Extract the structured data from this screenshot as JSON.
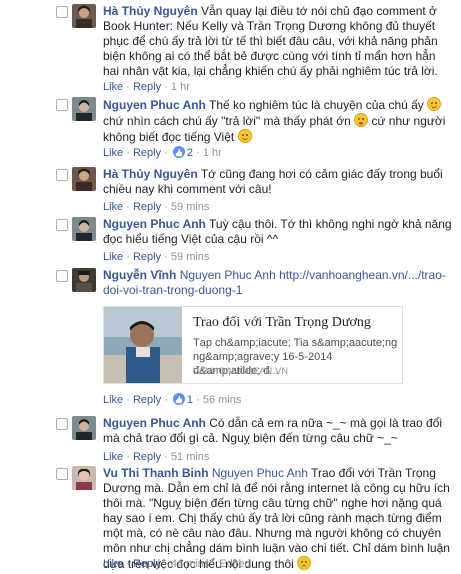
{
  "comments": [
    {
      "author": "Hà Thủy Nguyên",
      "body": "Vẫn quay lại điều tớ nói chủ đạo comment ở Book Hunter: Nếu Kelly và Trần Trọng Dương không đủ thuyết phục để chú ấy trả lời từ tế thì biết đâu câu, với khả năng phản biện không ai có thể bắt bẻ được cùng với tính tỉ mẩn hơn hẳn hai nhân vật kia, lại chẳng khiến chú ấy phải nghiêm túc trả lời.",
      "like": "Like",
      "reply": "Reply",
      "time": "1 hr"
    },
    {
      "author": "Nguyen Phuc Anh",
      "body_1": "Thế ko nghiêm túc là chuyện của chú ấy",
      "body_2": "chứ nhìn cách chú ấy \"trả lời\" mà thấy phát ớn",
      "body_3": "cứ như người không biết đọc tiếng Việt",
      "like": "Like",
      "reply": "Reply",
      "like_count": "2",
      "time": "1 hr"
    },
    {
      "author": "Hà Thủy Nguyên",
      "body": "Tớ cũng đang hơi có cảm giác đấy trong buổi chiều nay khi comment với câu!",
      "like": "Like",
      "reply": "Reply",
      "time": "59 mins"
    },
    {
      "author": "Nguyen Phuc Anh",
      "body": "Tuỳ cậu thôi. Tớ thì không nghi ngờ khả năng đọc hiểu tiếng Việt của cậu rồi ^^",
      "like": "Like",
      "reply": "Reply",
      "time": "59 mins"
    },
    {
      "author": "Nguyễn Vĩnh",
      "tagged": "Nguyen Phuc Anh",
      "link": "http://vanhoanghean.vn/.../trao-doi-voi-tran-trong-duong-1",
      "link_line1": "http://vanhoanghean.vn/.../trao-",
      "link_line2": "doi-voi-tran-trong-duong-1",
      "preview": {
        "title": "Trao đổi với Trần Trọng Dương",
        "desc_1": "Tạp ch&amp;iacute; Tia s&amp;aacute;ng",
        "desc_2": "ng&amp;agrave;y 16-5-2014 đ&amp;atilde; đ...",
        "domain": "VANHOANGHEAN.VN"
      },
      "like": "Like",
      "reply": "Reply",
      "like_count": "1",
      "time": "56 mins"
    },
    {
      "author": "Nguyen Phuc Anh",
      "body": "Có dẫn cả em ra nữa ~_~ mà gọi là trao đổi mà chả trao đổi gì cả. Nguỵ biện đến từng câu chữ ~_~",
      "like": "Like",
      "reply": "Reply",
      "time": "51 mins"
    },
    {
      "author": "Vu Thi Thanh Binh",
      "tagged": "Nguyen Phuc Anh",
      "body": "Trao đổi với Trần Trọng Dương mà. Dẫn em chỉ là để nói rằng internet là công cụ hữu ích thôi mà. \"Nguỵ biện đến từng câu từng chữ\" nghe hơi nặng quá hay sao í em. Chị thấy chú ấy trả lời cũng rành mạch từng điểm một mà, có nè câu nào đâu. Nhưng mà người không có chuyên môn như chị chẳng dám bình luận vào chi tiết. Chỉ dám bình luận dựa trên việc đọc hiểu nội dung thôi",
      "like": "Like",
      "reply": "Reply",
      "time": "44 mins",
      "edited": "Edited"
    }
  ],
  "colors": {
    "link": "#365899",
    "meta": "#90949c",
    "text": "#1d2129",
    "like_badge": "#5890ff"
  }
}
